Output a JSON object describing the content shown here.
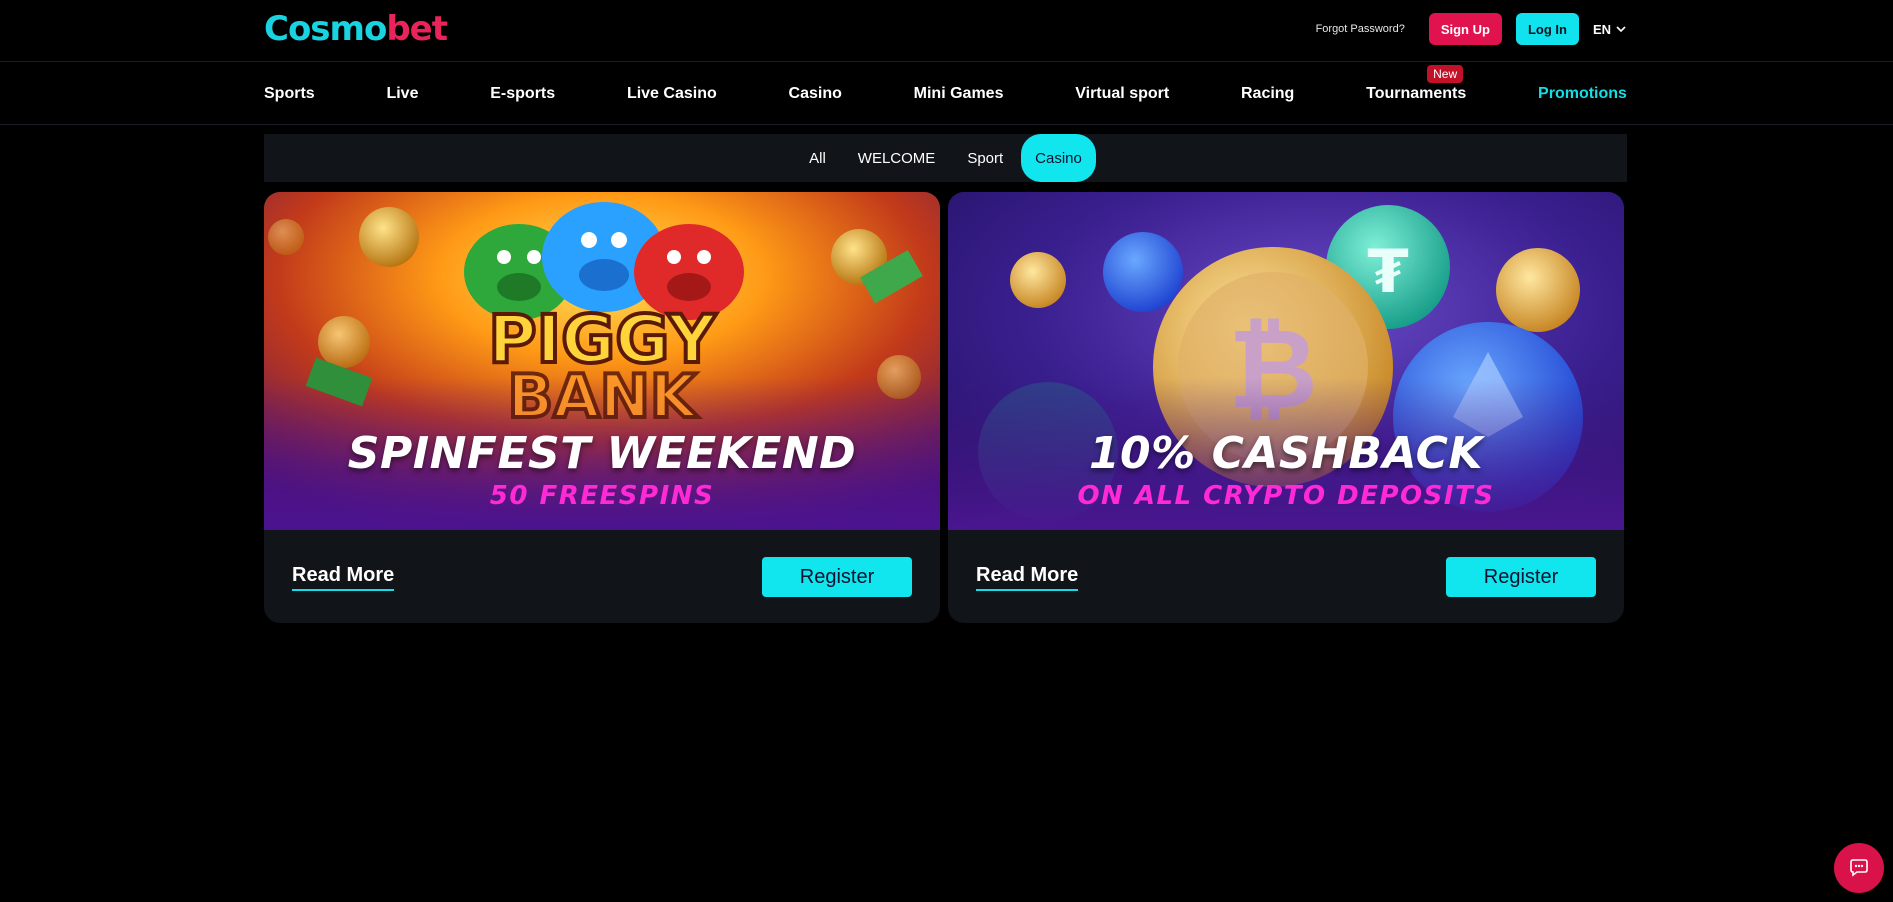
{
  "header": {
    "logo_part1": "Cosmo",
    "logo_part2": "bet",
    "forgot_password": "Forgot Password?",
    "signup_label": "Sign Up",
    "login_label": "Log In",
    "language": "EN"
  },
  "nav": {
    "items": [
      "Sports",
      "Live",
      "E-sports",
      "Live Casino",
      "Casino",
      "Mini Games",
      "Virtual sport",
      "Racing",
      "Tournaments",
      "Promotions"
    ],
    "new_badge": "New",
    "active": "Promotions"
  },
  "filters": {
    "items": [
      "All",
      "WELCOME",
      "Sport",
      "Casino"
    ],
    "active": "Casino"
  },
  "promotions": [
    {
      "title": "SPINFEST WEEKEND",
      "subtitle": "50 FREESPINS",
      "banner_logo": "PIGGY BANK",
      "read_more": "Read More",
      "register": "Register"
    },
    {
      "title": "10% CASHBACK",
      "subtitle": "ON ALL CRYPTO DEPOSITS",
      "read_more": "Read More",
      "register": "Register"
    }
  ],
  "colors": {
    "accent_cyan": "#11e6ee",
    "accent_pink": "#e0134f",
    "background": "#000000",
    "card_bg": "#111418"
  },
  "icons": {
    "chat": "chat-bubble-icon",
    "language_caret": "chevron-down-icon"
  }
}
